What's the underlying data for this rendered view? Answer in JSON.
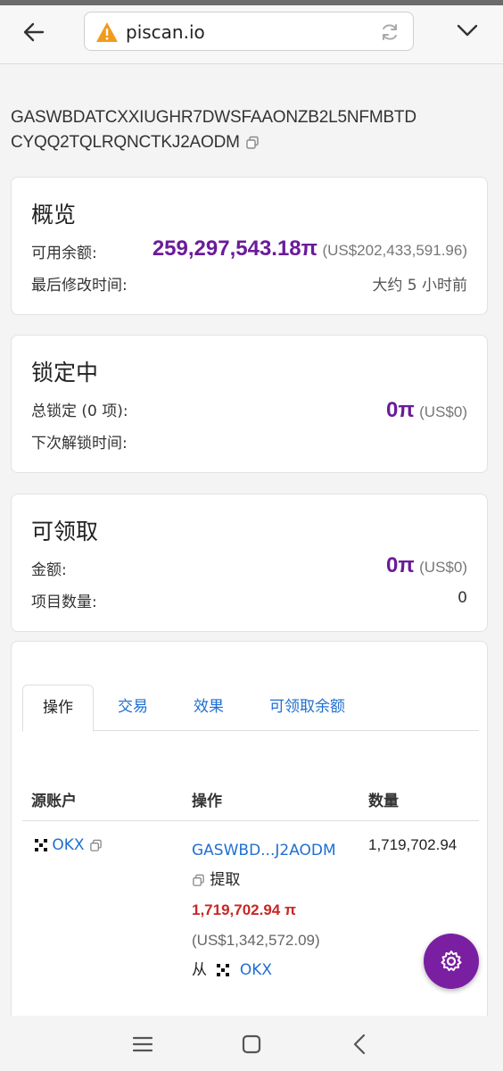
{
  "browser": {
    "url": "piscan.io",
    "icons": {
      "back": "back-arrow-icon",
      "warning": "warning-icon",
      "reload": "reload-icon",
      "menu": "chevron-down-icon"
    }
  },
  "account": {
    "address_line1": "GASWBDATCXXIUGHR7DWSFAAONZB2L5NFMBTD",
    "address_line2": "CYQQ2TQLRQNCTKJ2AODM"
  },
  "overview": {
    "title": "概览",
    "available_label": "可用余额:",
    "available_value": "259,297,543.18π",
    "available_usd": "(US$202,433,591.96)",
    "modified_label": "最后修改时间:",
    "modified_value": "大约 5 小时前"
  },
  "locked": {
    "title": "锁定中",
    "total_label": "总锁定 (0 项):",
    "total_value": "0π",
    "total_usd": "(US$0)",
    "next_unlock_label": "下次解锁时间:"
  },
  "claimable": {
    "title": "可领取",
    "amount_label": "金额:",
    "amount_value": "0π",
    "amount_usd": "(US$0)",
    "count_label": "项目数量:",
    "count_value": "0"
  },
  "tabs": [
    {
      "label": "操作",
      "active": true
    },
    {
      "label": "交易",
      "active": false
    },
    {
      "label": "效果",
      "active": false
    },
    {
      "label": "可领取余额",
      "active": false
    }
  ],
  "table": {
    "headers": [
      "源账户",
      "操作",
      "数量"
    ],
    "rows": [
      {
        "source": "OKX",
        "op_account": "GASWBD...J2AODM",
        "op_type": "提取",
        "op_amount": "1,719,702.94 π",
        "op_usd": "(US$1,342,572.09)",
        "op_from_label": "从",
        "op_from": "OKX",
        "quantity": "1,719,702.94"
      }
    ]
  },
  "colors": {
    "accent_purple": "#6a1b9a",
    "link_blue": "#1f6fd1",
    "amount_red": "#c62828",
    "fab": "#7b1fa2"
  }
}
